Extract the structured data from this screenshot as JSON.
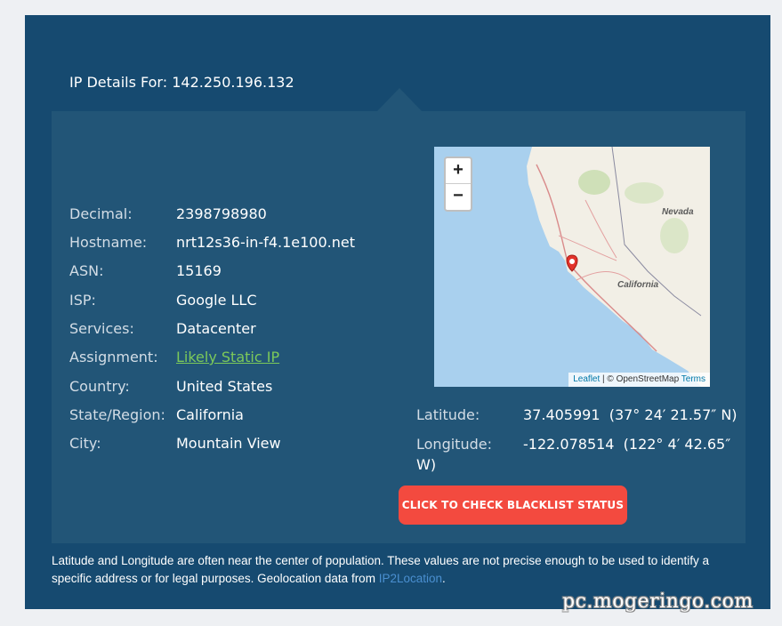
{
  "header": {
    "title": "IP Details For: 142.250.196.132"
  },
  "details": [
    {
      "label": "Decimal:",
      "value": "2398798980"
    },
    {
      "label": "Hostname:",
      "value": "nrt12s36-in-f4.1e100.net"
    },
    {
      "label": "ASN:",
      "value": "15169"
    },
    {
      "label": "ISP:",
      "value": "Google LLC"
    },
    {
      "label": "Services:",
      "value": "Datacenter"
    },
    {
      "label": "Assignment:",
      "value": "Likely Static IP"
    },
    {
      "label": "Country:",
      "value": "United States"
    },
    {
      "label": "State/Region:",
      "value": "California"
    },
    {
      "label": "City:",
      "value": "Mountain View"
    }
  ],
  "coords": {
    "latitude_label": "Latitude:",
    "latitude_value": "37.405991  (37° 24′ 21.57″ N)",
    "longitude_label": "Longitude:",
    "longitude_value_line1": "-122.078514  (122° 4′ 42.65″",
    "longitude_value_line2": "W)"
  },
  "map": {
    "zoom_in": "+",
    "zoom_out": "−",
    "label_nevada": "Nevada",
    "label_california": "California",
    "attrib_leaflet": "Leaflet",
    "attrib_sep": " | © OpenStreetMap ",
    "attrib_terms": "Terms"
  },
  "blacklist_button": "CLICK TO CHECK BLACKLIST STATUS",
  "note": {
    "text": "Latitude and Longitude are often near the center of population. These values are not precise enough to be used to identify a specific address or for legal purposes. Geolocation data from ",
    "link": "IP2Location",
    "end": "."
  },
  "watermark": "pc.mogeringo.com",
  "colors": {
    "outer_bg": "#164a70",
    "panel_bg": "#225577",
    "link_green": "#7cc95a",
    "button_red": "#f34a3f",
    "map_water": "#a9d0ee",
    "map_land": "#f2efe6"
  }
}
